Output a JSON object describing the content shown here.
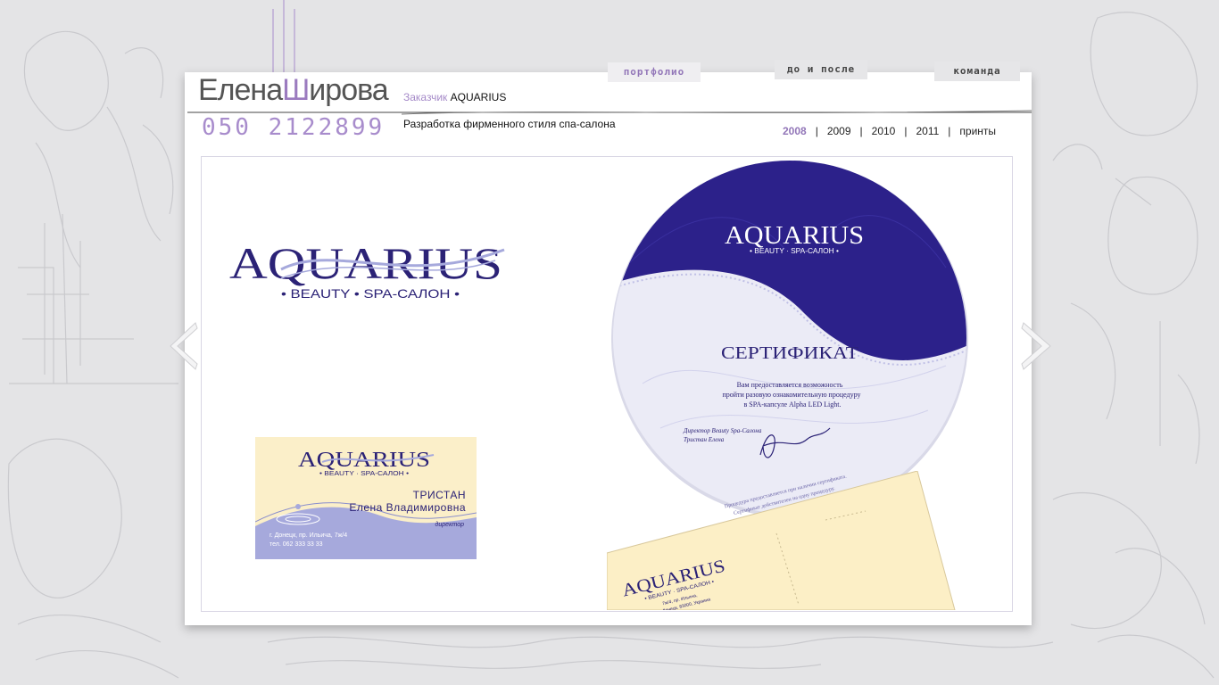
{
  "site": {
    "logo_first": "Елена",
    "logo_big": "Ш",
    "logo_rest": "ирова",
    "phone": "050 2122899"
  },
  "nav": {
    "portfolio": "портфолио",
    "before_after": "до и после",
    "team": "команда"
  },
  "project": {
    "client_label": "Заказчик",
    "client_name": "AQUARIUS",
    "description": "Разработка фирменного стиля спа-салона"
  },
  "years": {
    "items": [
      "2008",
      "2009",
      "2010",
      "2011",
      "принты"
    ],
    "active": "2008"
  },
  "brand": {
    "name": "AQUARIUS",
    "tagline": "• BEAUTY • SPA-САЛОН •",
    "tagline_small": "• BEAUTY · SPA-САЛОН •",
    "color_primary": "#2b2276",
    "color_light": "#a6a9dc",
    "color_cream": "#fbefc9"
  },
  "business_card": {
    "surname": "ТРИСТАН",
    "name": "Елена Владимировна",
    "role": "директор",
    "address": "г. Донецк, пр. Ильича, 7ж/4",
    "phone": "тел. 062 333 33 33"
  },
  "certificate": {
    "title": "СЕРТИФИКАТ",
    "line1": "Вам предоставляется возможность",
    "line2": "пройти разовую ознакомительную процедуру",
    "line3": "в SPA-капсуле Alpha LED Light.",
    "sign1": "Директор Beauty Spa-Салона",
    "sign2": "Тристан Елена",
    "note1": "Процедура предоставляется при наличии сертификата.",
    "note2": "Сертификат действителен на одну процедуру.",
    "note3": "Срок действия сертификата"
  },
  "envelope": {
    "addr1": "7ж/4, пр. Ильича,",
    "addr2": "г. Донецк, 83000, Украина"
  }
}
